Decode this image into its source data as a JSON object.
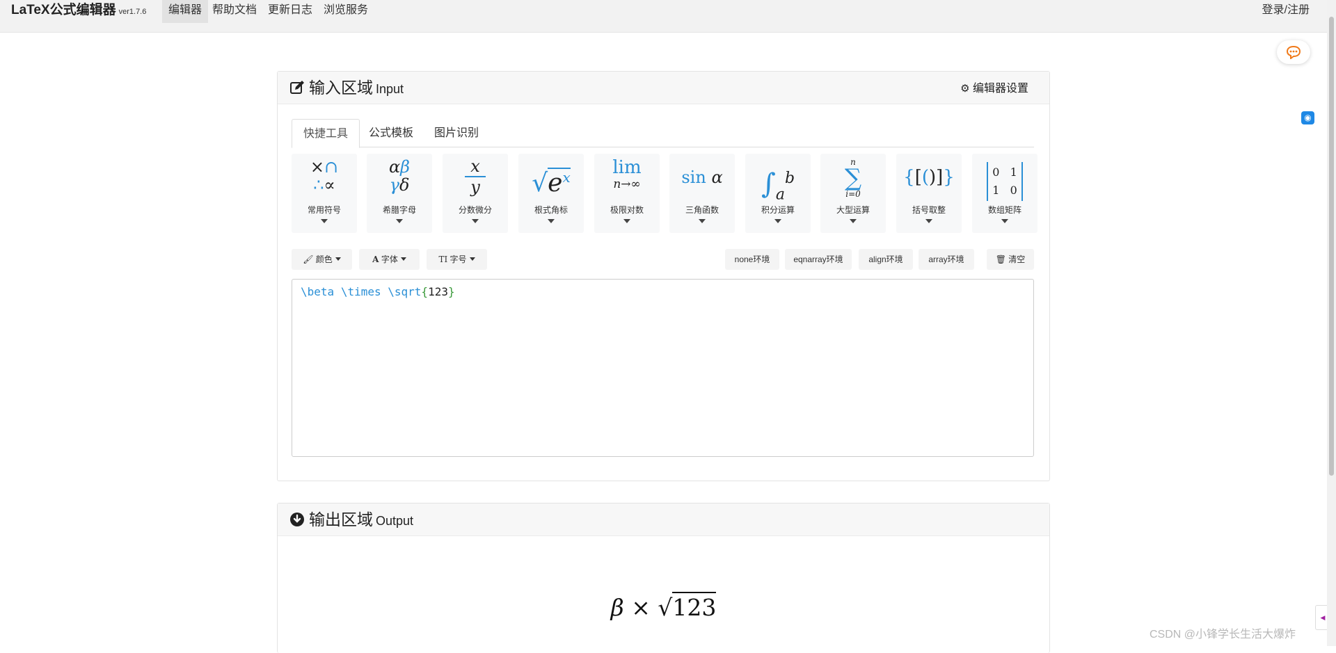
{
  "navbar": {
    "brand": "LaTeX公式编辑器",
    "version": "ver1.7.6",
    "items": [
      "编辑器",
      "帮助文档",
      "更新日志",
      "浏览服务"
    ],
    "login": "登录/注册"
  },
  "input_panel": {
    "title_cn": "输入区域",
    "title_en": "Input",
    "settings_label": "编辑器设置",
    "tabs": [
      "快捷工具",
      "公式模板",
      "图片识别"
    ],
    "tools": [
      "常用符号",
      "希腊字母",
      "分数微分",
      "根式角标",
      "极限对数",
      "三角函数",
      "积分运算",
      "大型运算",
      "括号取整",
      "数组矩阵"
    ],
    "toolbar": {
      "color": "颜色",
      "font": "字体",
      "size": "字号",
      "env_none": "none环境",
      "env_eqnarray": "eqnarray环境",
      "env_align": "align环境",
      "env_array": "array环境",
      "clear": "清空"
    },
    "code": {
      "beta": "\\beta",
      "times": "\\times",
      "sqrt": "\\sqrt",
      "open": "{",
      "arg": "123",
      "close": "}"
    }
  },
  "output_panel": {
    "title_cn": "输出区域",
    "title_en": "Output",
    "beta": "β",
    "times": "×",
    "radicand": "123"
  },
  "watermark": "CSDN @小锋学长生活大爆炸",
  "colors": {
    "accent_blue": "#2a8fd6",
    "chat_orange": "#f07a1a",
    "brace_green": "#3a9a3a"
  }
}
